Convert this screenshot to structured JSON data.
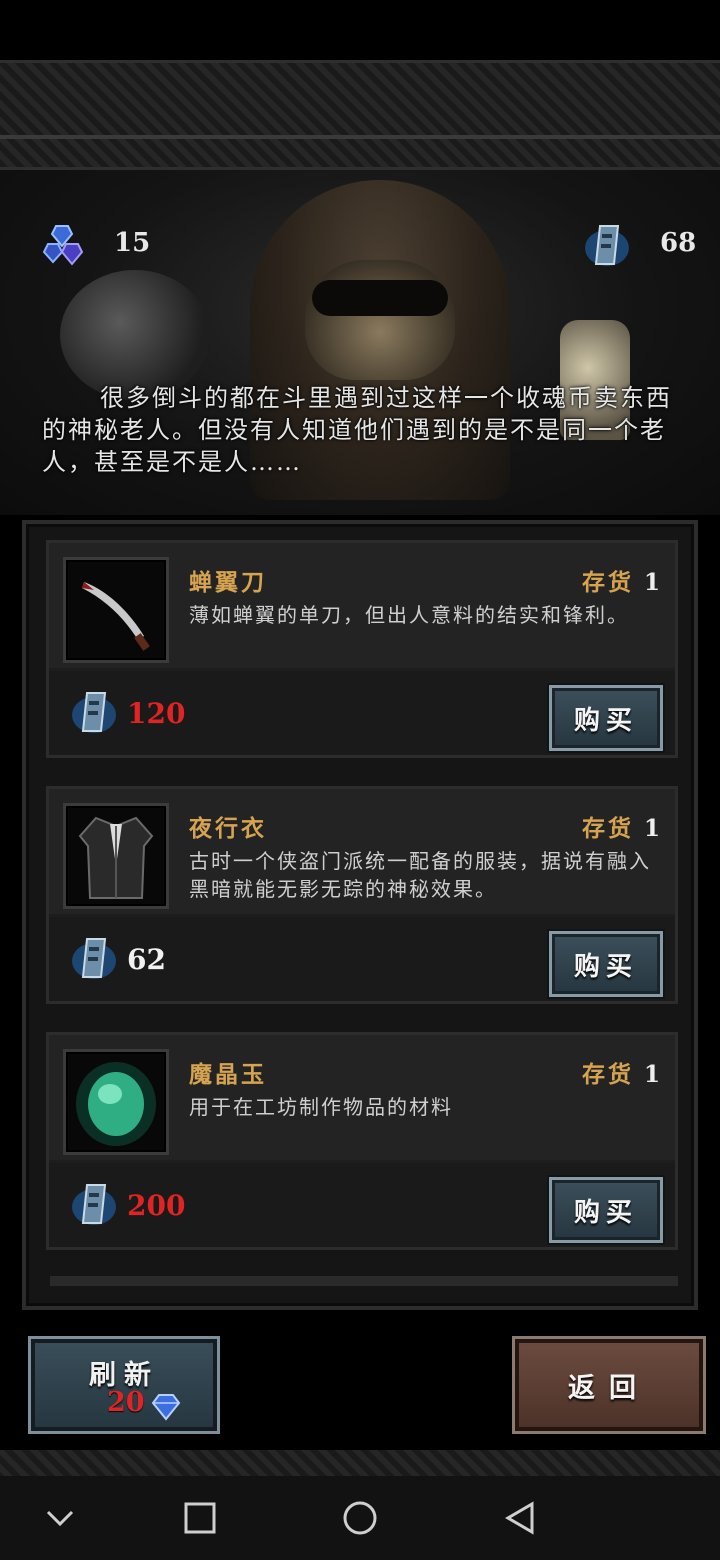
{
  "stats": {
    "gems": "15",
    "coins": "68"
  },
  "intro_text": "很多倒斗的都在斗里遇到过这样一个收魂币卖东西的神秘老人。但没有人知道他们遇到的是不是同一个老人，甚至是不是人……",
  "shop": {
    "stock_label": "存货",
    "buy_label": "购买",
    "items": [
      {
        "name": "蝉翼刀",
        "stock": "1",
        "desc": "薄如蝉翼的单刀，但出人意料的结实和锋利。",
        "price": "120",
        "price_color": "#e02424",
        "icon": "saber-icon"
      },
      {
        "name": "夜行衣",
        "stock": "1",
        "desc": "古时一个侠盗门派统一配备的服装，据说有融入黑暗就能无影无踪的神秘效果。",
        "price": "62",
        "price_color": "#f1f1f1",
        "icon": "black-robe-icon"
      },
      {
        "name": "魔晶玉",
        "stock": "1",
        "desc": "用于在工坊制作物品的材料",
        "price": "200",
        "price_color": "#e02424",
        "icon": "green-crystal-icon"
      }
    ]
  },
  "refresh": {
    "label": "刷新",
    "cost": "20"
  },
  "back": {
    "label": "返回"
  },
  "nav": {
    "back_icon": "chevron-down-icon",
    "home_icon": "circle-icon",
    "recents_icon": "square-icon",
    "return_icon": "triangle-back-icon"
  }
}
